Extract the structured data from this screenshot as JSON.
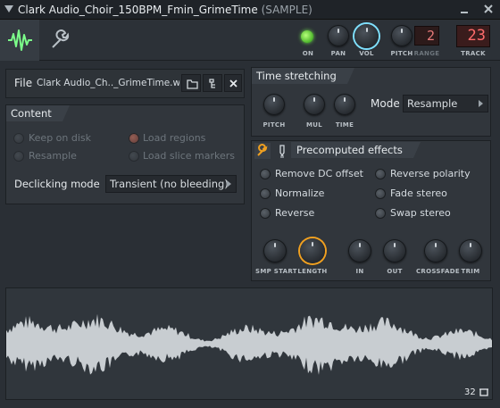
{
  "window": {
    "title": "Clark Audio_Choir_150BPM_Fmin_GrimeTime",
    "title_suffix": "(SAMPLE)"
  },
  "toolbar": {
    "on_label": "ON",
    "pan_label": "PAN",
    "vol_label": "VOL",
    "pitch_label": "PITCH",
    "range_label": "RANGE",
    "range_value": "2",
    "track_label": "TRACK",
    "track_value": "23",
    "accent_color": "#7fe0ff",
    "led_color": "#6fe04a"
  },
  "file": {
    "label": "File",
    "name": "Clark Audio_Ch.._GrimeTime.wav"
  },
  "content": {
    "title": "Content",
    "options": {
      "keep_on_disk": "Keep on disk",
      "load_regions": "Load regions",
      "resample": "Resample",
      "load_slice_markers": "Load slice markers"
    },
    "declicking_label": "Declicking mode",
    "declicking_value": "Transient (no bleeding)"
  },
  "time_stretching": {
    "title": "Time stretching",
    "pitch_label": "PITCH",
    "mul_label": "MUL",
    "time_label": "TIME",
    "mode_label": "Mode",
    "mode_value": "Resample"
  },
  "precomputed": {
    "title": "Precomputed effects",
    "effects": {
      "remove_dc": "Remove DC offset",
      "reverse_polarity": "Reverse polarity",
      "normalize": "Normalize",
      "fade_stereo": "Fade stereo",
      "reverse": "Reverse",
      "swap_stereo": "Swap stereo"
    },
    "knobs": {
      "smp_start": "SMP START",
      "length": "LENGTH",
      "in": "IN",
      "out": "OUT",
      "crossfade": "CROSSFADE",
      "trim": "TRIM"
    },
    "length_ring_color": "#f0a020"
  },
  "waveform": {
    "counter": "32",
    "color": "#c8cdd1"
  }
}
